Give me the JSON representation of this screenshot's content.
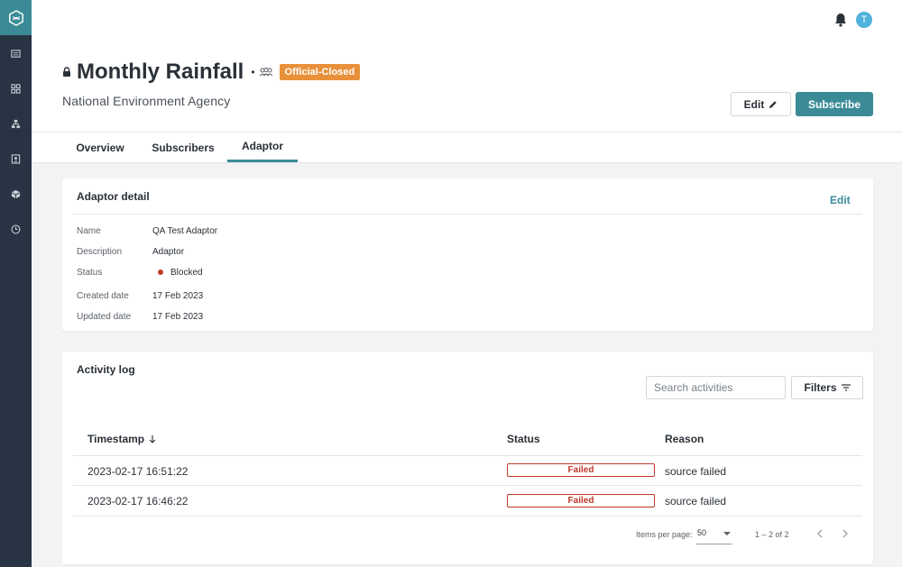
{
  "dataset": {
    "title": "Monthly Rainfall",
    "separator": "•",
    "classification": "Official-Closed",
    "agency": "National Environment Agency",
    "edit_label": "Edit",
    "subscribe_label": "Subscribe"
  },
  "header": {
    "avatar_initial": "T"
  },
  "tabs": [
    {
      "label": "Overview"
    },
    {
      "label": "Subscribers"
    },
    {
      "label": "Adaptor"
    }
  ],
  "adaptor_detail": {
    "title": "Adaptor detail",
    "edit_label": "Edit",
    "fields": [
      {
        "label": "Name",
        "value": "QA Test Adaptor"
      },
      {
        "label": "Description",
        "value": "Adaptor"
      },
      {
        "label": "Status",
        "value": "Blocked"
      },
      {
        "label": "Created date",
        "value": "17 Feb 2023"
      },
      {
        "label": "Updated date",
        "value": "17 Feb 2023"
      }
    ]
  },
  "activity_log": {
    "title": "Activity log",
    "search_placeholder": "Search activities",
    "filters_label": "Filters",
    "columns": [
      "Timestamp",
      "Status",
      "Reason"
    ],
    "rows": [
      {
        "timestamp": "2023-02-17 16:51:22",
        "status": "Failed",
        "reason": "source failed"
      },
      {
        "timestamp": "2023-02-17 16:46:22",
        "status": "Failed",
        "reason": "source failed"
      }
    ],
    "pager": {
      "items_per_page_label": "Items per page:",
      "items_per_page": "50",
      "range": "1 – 2 of 2"
    }
  },
  "colors": {
    "accent": "#3b8b97",
    "rail": "#283343",
    "badge": "#e8913a",
    "error": "#c0392b",
    "avatar": "#4fb2dc"
  }
}
